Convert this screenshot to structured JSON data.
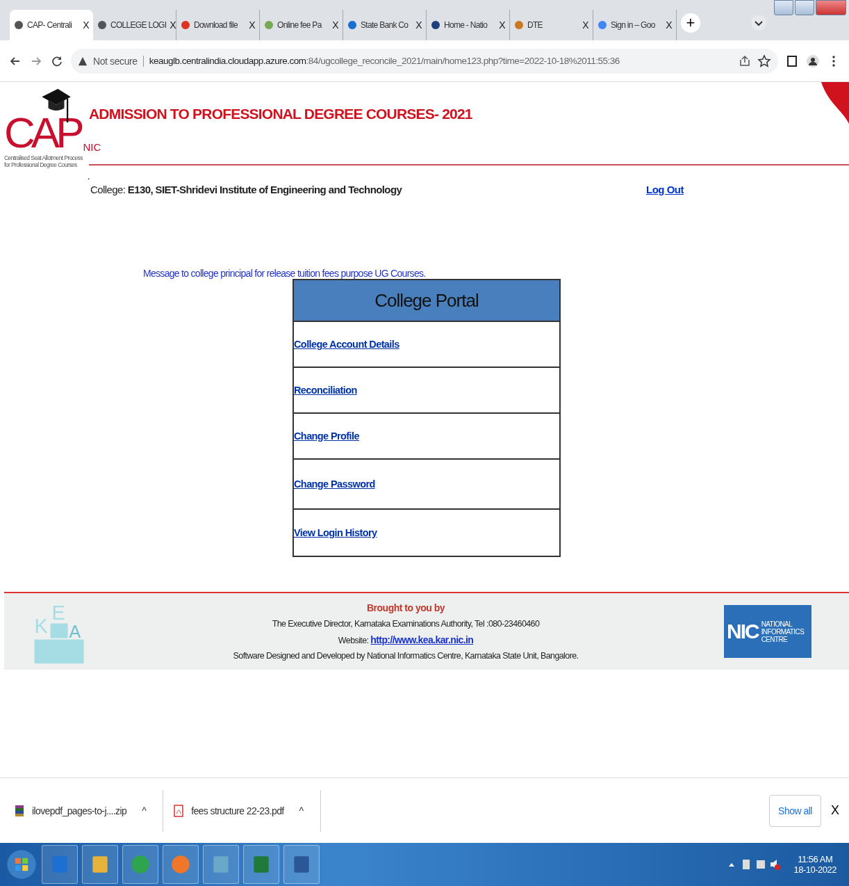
{
  "browser": {
    "tabs": [
      {
        "title": "CAP- Centrali",
        "close": "X",
        "selected": true
      },
      {
        "title": "COLLEGE LOGI",
        "close": "X",
        "selected": false
      },
      {
        "title": "Download file",
        "close": "X",
        "selected": false
      },
      {
        "title": "Online fee Pa",
        "close": "X",
        "selected": false
      },
      {
        "title": "State Bank Co",
        "close": "X",
        "selected": false
      },
      {
        "title": "Home - Natio",
        "close": "X",
        "selected": false
      },
      {
        "title": "DTE",
        "close": "X",
        "selected": false
      },
      {
        "title": "Sign in – Goo",
        "close": "X",
        "selected": false
      }
    ],
    "new_tab": "+",
    "security": "Not secure",
    "url_host": "keauglb.centralindia.cloudapp.azure.com",
    "url_path": ":84/ugcollege_reconcile_2021/main/home123.php?time=2022-10-18%2011:55:36"
  },
  "header": {
    "logo_main": "CAP",
    "logo_sub": "NIC",
    "logo_caption_1": "Centralised Seat Allotment Process",
    "logo_caption_2": "for Professional Degree Courses",
    "title": "ADMISSION TO PROFESSIONAL DEGREE COURSES- 2021",
    "dot": "."
  },
  "college": {
    "label": "College:",
    "value": "E130, SIET-Shridevi Institute of Engineering and Technology",
    "logout": "Log Out"
  },
  "message_link": "Message to college principal for release tuition fees purpose UG Courses.",
  "portal": {
    "title": "College Portal",
    "links": [
      "College Account Details",
      "Reconciliation",
      "Change Profile",
      "Change Password",
      "View  Login History"
    ]
  },
  "footer": {
    "kea_letters": [
      "K",
      "E",
      "A"
    ],
    "brought": "Brought to you by",
    "line_1": "The Executive Director, Karnataka Examinations Authority, Tel :080-23460460",
    "website_label": "Website:",
    "website_link": "http://www.kea.kar.nic.in",
    "line_3": "Software Designed and Developed by National Informatics Centre, Karnataka State Unit, Bangalore.",
    "nic_short": "NIC",
    "nic_lines": [
      "NATIONAL",
      "INFORMATICS",
      "CENTRE"
    ]
  },
  "downloads": {
    "items": [
      {
        "name": "ilovepdf_pages-to-j....zip",
        "kind": "zip",
        "caret": "^"
      },
      {
        "name": "fees structure 22-23.pdf",
        "kind": "pdf",
        "caret": "^"
      }
    ],
    "show_all": "Show all",
    "close": "X"
  },
  "taskbar": {
    "time": "11:56 AM",
    "date": "18-10-2022"
  }
}
